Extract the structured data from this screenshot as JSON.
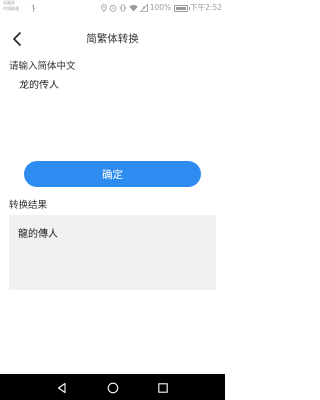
{
  "status_bar": {
    "carrier_line1": "无服务",
    "carrier_line2": "中国联通",
    "battery_percent": "100%",
    "battery_level": 1.0,
    "time": "下午2:52"
  },
  "header": {
    "back_icon": "chevron-left-icon",
    "title": "简繁体转换"
  },
  "input": {
    "label": "请输入简体中文",
    "value": "龙的传人"
  },
  "confirm_button": {
    "label": "确定",
    "color": "#2e8cf0"
  },
  "result": {
    "label": "转换结果",
    "value": "龍的傳人"
  },
  "nav_bar": {
    "back_icon": "triangle-back-icon",
    "home_icon": "circle-home-icon",
    "recent_icon": "square-recent-icon"
  }
}
